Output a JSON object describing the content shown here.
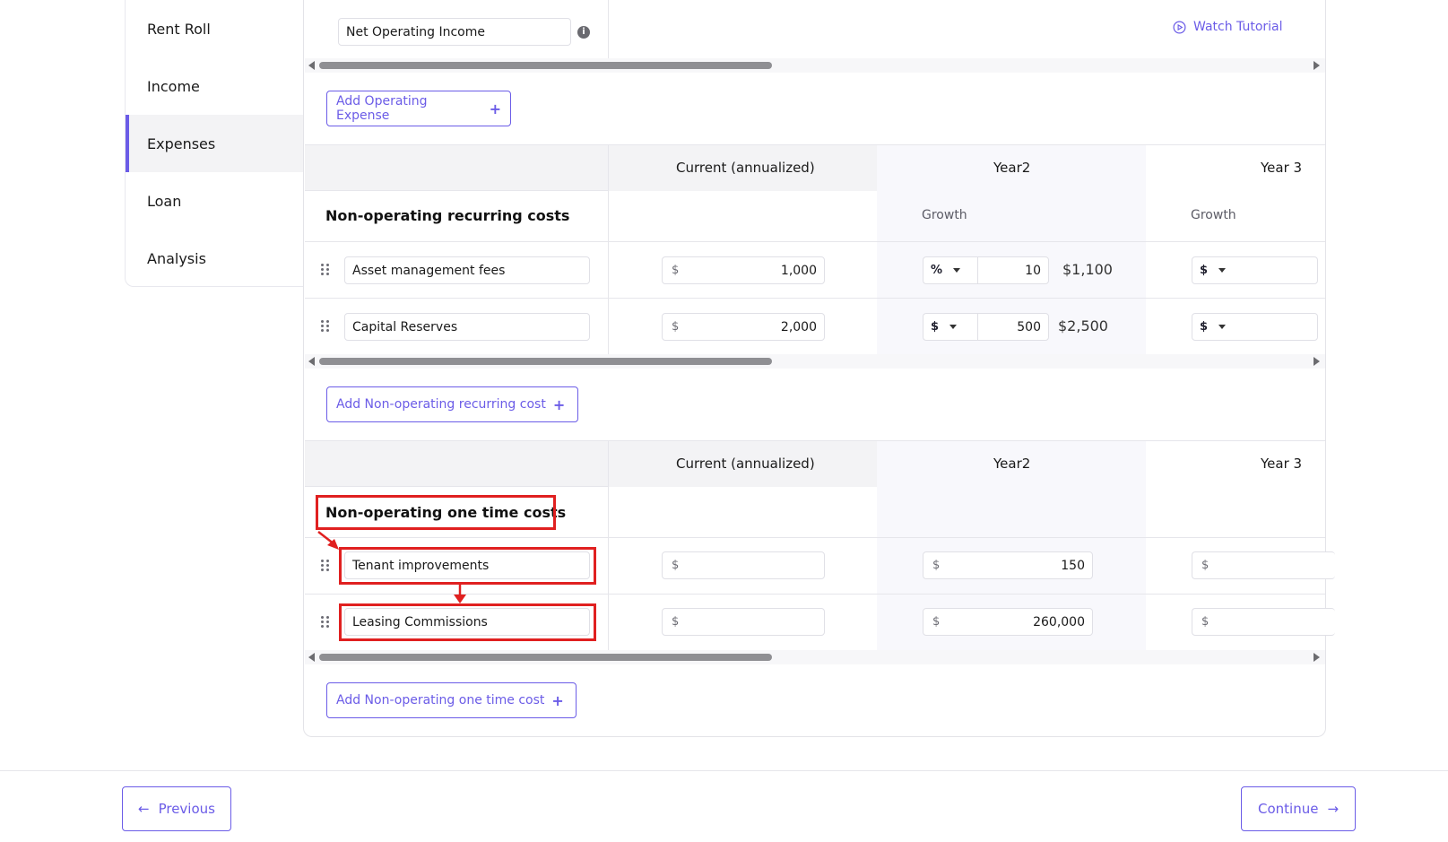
{
  "sidebar": {
    "items": [
      {
        "label": "Rent Roll"
      },
      {
        "label": "Income"
      },
      {
        "label": "Expenses"
      },
      {
        "label": "Loan"
      },
      {
        "label": "Analysis"
      }
    ],
    "active_index": 2
  },
  "top": {
    "noi_value": "Net Operating Income",
    "tutorial_label": "Watch Tutorial",
    "add_operating_expense": "Add Operating Expense"
  },
  "recurring": {
    "title": "Non-operating recurring costs",
    "headers": [
      "Current (annualized)",
      "Year2",
      "Year 3"
    ],
    "growth_label": "Growth",
    "rows": [
      {
        "name": "Asset management fees",
        "currency": "$",
        "current": "1,000",
        "unit": "%",
        "growth_value": "10",
        "computed": "$1,100",
        "year3_unit": "$"
      },
      {
        "name": "Capital Reserves",
        "currency": "$",
        "current": "2,000",
        "unit": "$",
        "growth_value": "500",
        "computed": "$2,500",
        "year3_unit": "$"
      }
    ],
    "add_label": "Add Non-operating recurring cost"
  },
  "onetime": {
    "title": "Non-operating one time costs",
    "headers": [
      "Current (annualized)",
      "Year2",
      "Year 3"
    ],
    "rows": [
      {
        "name": "Tenant improvements",
        "currency": "$",
        "current": "",
        "year2": "150",
        "year3": ""
      },
      {
        "name": "Leasing Commissions",
        "currency": "$",
        "current": "",
        "year2": "260,000",
        "year3": ""
      }
    ],
    "add_label": "Add Non-operating one time cost"
  },
  "footer": {
    "previous_label": "Previous",
    "continue_label": "Continue"
  },
  "colors": {
    "accent": "#6b5ce7",
    "highlight": "#e02020"
  }
}
